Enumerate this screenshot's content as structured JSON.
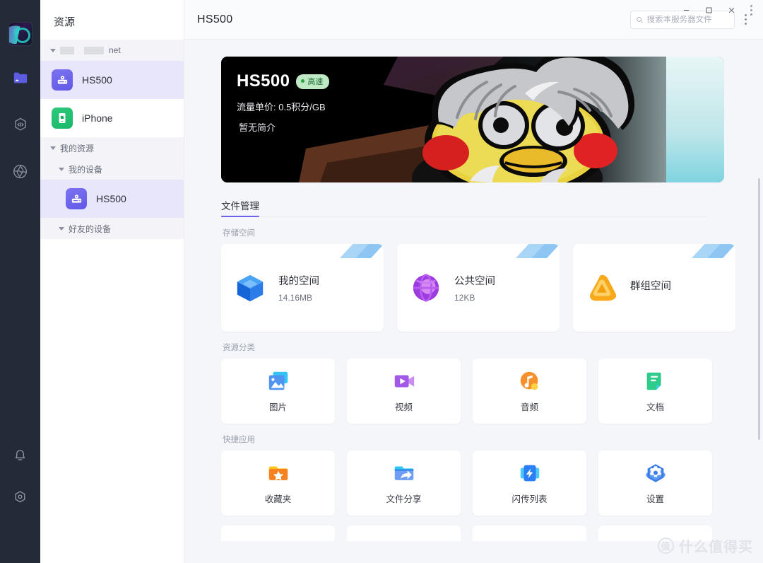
{
  "window": {
    "minimize_label": "─",
    "maximize_label": "□",
    "close_label": "✕",
    "more_label": "more-options"
  },
  "rail": {
    "avatar_name": "user-avatar",
    "items": [
      {
        "id": "files",
        "icon": "folder-icon",
        "active": true
      },
      {
        "id": "transfer",
        "icon": "hex-transfer-icon",
        "active": false
      },
      {
        "id": "discover",
        "icon": "aperture-icon",
        "active": false
      }
    ],
    "bottom_items": [
      {
        "id": "notifications",
        "icon": "bell-icon"
      },
      {
        "id": "settings",
        "icon": "hex-settings-icon"
      }
    ]
  },
  "sidebar": {
    "title": "资源",
    "network_group": {
      "label_suffix": "net",
      "redacted": true
    },
    "devices": [
      {
        "label": "HS500",
        "icon": "nas-device-icon",
        "selected": true
      },
      {
        "label": "iPhone",
        "icon": "iphone-device-icon",
        "selected": false
      }
    ],
    "groups": [
      {
        "label": "我的资源",
        "indent": false
      },
      {
        "label": "我的设备",
        "indent": true
      }
    ],
    "my_devices": [
      {
        "label": "HS500",
        "icon": "nas-device-icon",
        "selected": true
      }
    ],
    "friends_group": {
      "label": "好友的设备"
    }
  },
  "header": {
    "title": "HS500",
    "search": {
      "placeholder": "搜索本服务器文件",
      "value": "",
      "icon": "search-icon"
    }
  },
  "banner": {
    "name": "HS500",
    "badge": {
      "label": "高速",
      "color": "#bfe8c4",
      "text_color": "#1d6b35"
    },
    "price_line": "流量单价: 0.5积分/GB",
    "intro_line": "暂无简介",
    "artwork": "cartoon-chick-gray-hair"
  },
  "tabs": [
    {
      "label": "文件管理",
      "active": true
    }
  ],
  "sections": {
    "storage": {
      "label": "存储空间",
      "cards": [
        {
          "name": "我的空间",
          "size": "14.16MB",
          "icon": "blue-cube-icon"
        },
        {
          "name": "公共空间",
          "size": "12KB",
          "icon": "purple-globe-icon"
        },
        {
          "name": "群组空间",
          "size": "",
          "icon": "orange-triangle-icon"
        }
      ]
    },
    "categories": {
      "label": "资源分类",
      "cards": [
        {
          "name": "图片",
          "icon": "image-icon"
        },
        {
          "name": "视频",
          "icon": "video-icon"
        },
        {
          "name": "音频",
          "icon": "audio-icon"
        },
        {
          "name": "文档",
          "icon": "document-icon"
        }
      ]
    },
    "quick_apps": {
      "label": "快捷应用",
      "cards": [
        {
          "name": "收藏夹",
          "icon": "favorites-folder-icon"
        },
        {
          "name": "文件分享",
          "icon": "share-folder-icon"
        },
        {
          "name": "闪传列表",
          "icon": "flash-transfer-icon"
        },
        {
          "name": "设置",
          "icon": "settings-gear-icon"
        }
      ]
    }
  },
  "watermark": {
    "badge": "值",
    "text": "什么值得买"
  },
  "colors": {
    "accent": "#6b63e8",
    "rail_bg": "#242b38",
    "selected_row": "#e7e6fb",
    "page_bg": "#f5f6fa"
  }
}
